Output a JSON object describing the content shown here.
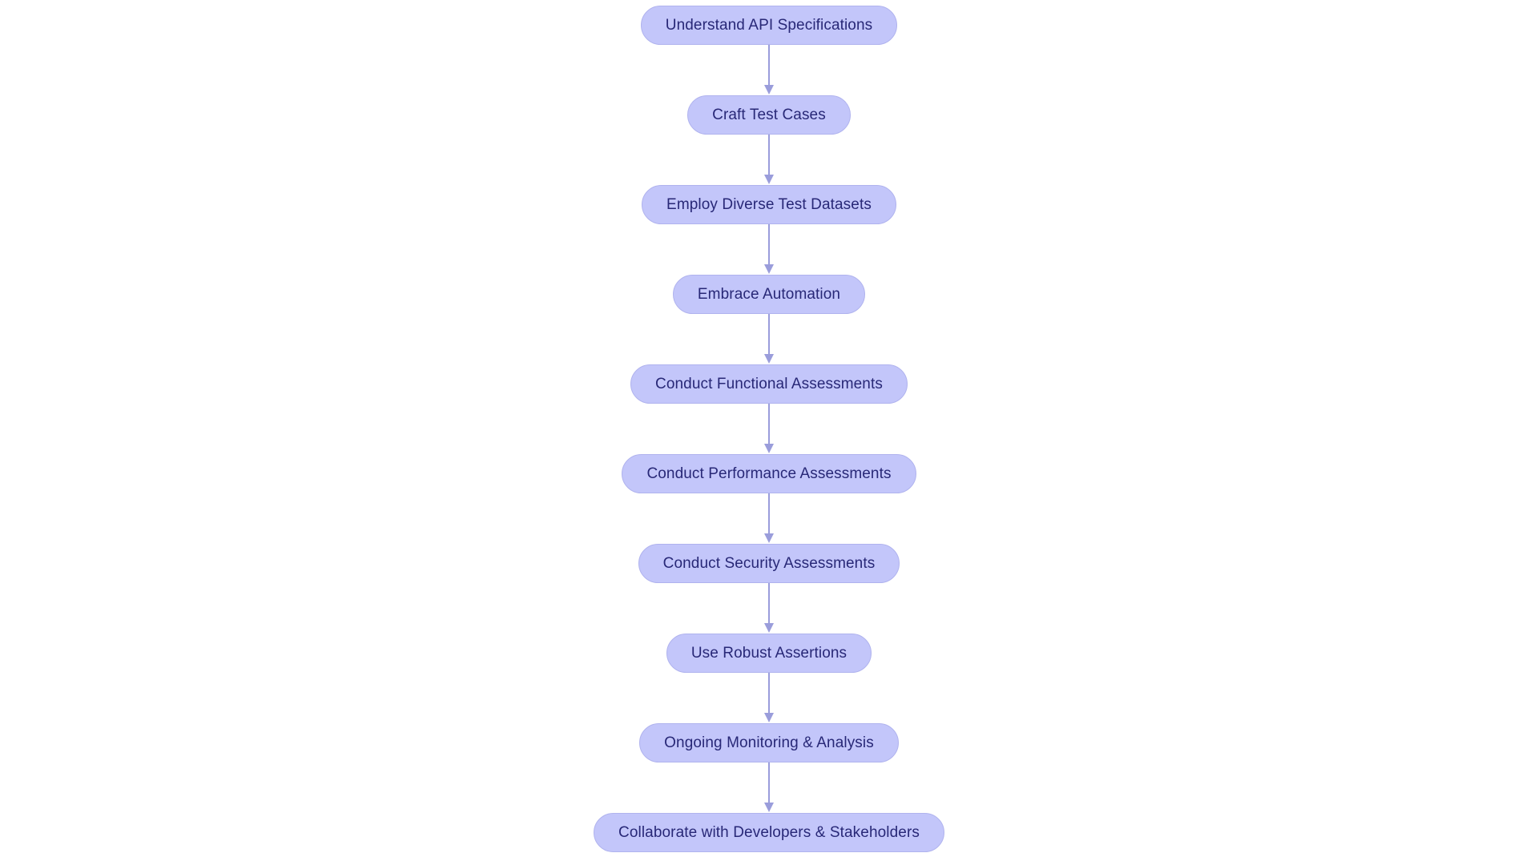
{
  "diagram": {
    "type": "flowchart",
    "orientation": "vertical-top-to-bottom",
    "background_color": "#ffffff",
    "node_fill_color": "#c3c6fa",
    "node_border_color": "#b0b3ee",
    "node_text_color": "#282877",
    "edge_color": "#9a9ddb",
    "nodes": [
      {
        "id": "n1",
        "label": "Understand API Specifications"
      },
      {
        "id": "n2",
        "label": "Craft Test Cases"
      },
      {
        "id": "n3",
        "label": "Employ Diverse Test Datasets"
      },
      {
        "id": "n4",
        "label": "Embrace Automation"
      },
      {
        "id": "n5",
        "label": "Conduct Functional Assessments"
      },
      {
        "id": "n6",
        "label": "Conduct Performance Assessments"
      },
      {
        "id": "n7",
        "label": "Conduct Security Assessments"
      },
      {
        "id": "n8",
        "label": "Use Robust Assertions"
      },
      {
        "id": "n9",
        "label": "Ongoing Monitoring & Analysis"
      },
      {
        "id": "n10",
        "label": "Collaborate with Developers & Stakeholders"
      }
    ],
    "edges": [
      {
        "from": "n1",
        "to": "n2",
        "arrow": "down-arrow"
      },
      {
        "from": "n2",
        "to": "n3",
        "arrow": "down-arrow"
      },
      {
        "from": "n3",
        "to": "n4",
        "arrow": "down-arrow"
      },
      {
        "from": "n4",
        "to": "n5",
        "arrow": "down-arrow"
      },
      {
        "from": "n5",
        "to": "n6",
        "arrow": "down-arrow"
      },
      {
        "from": "n6",
        "to": "n7",
        "arrow": "down-arrow"
      },
      {
        "from": "n7",
        "to": "n8",
        "arrow": "down-arrow"
      },
      {
        "from": "n8",
        "to": "n9",
        "arrow": "down-arrow"
      },
      {
        "from": "n9",
        "to": "n10",
        "arrow": "down-arrow"
      }
    ]
  }
}
